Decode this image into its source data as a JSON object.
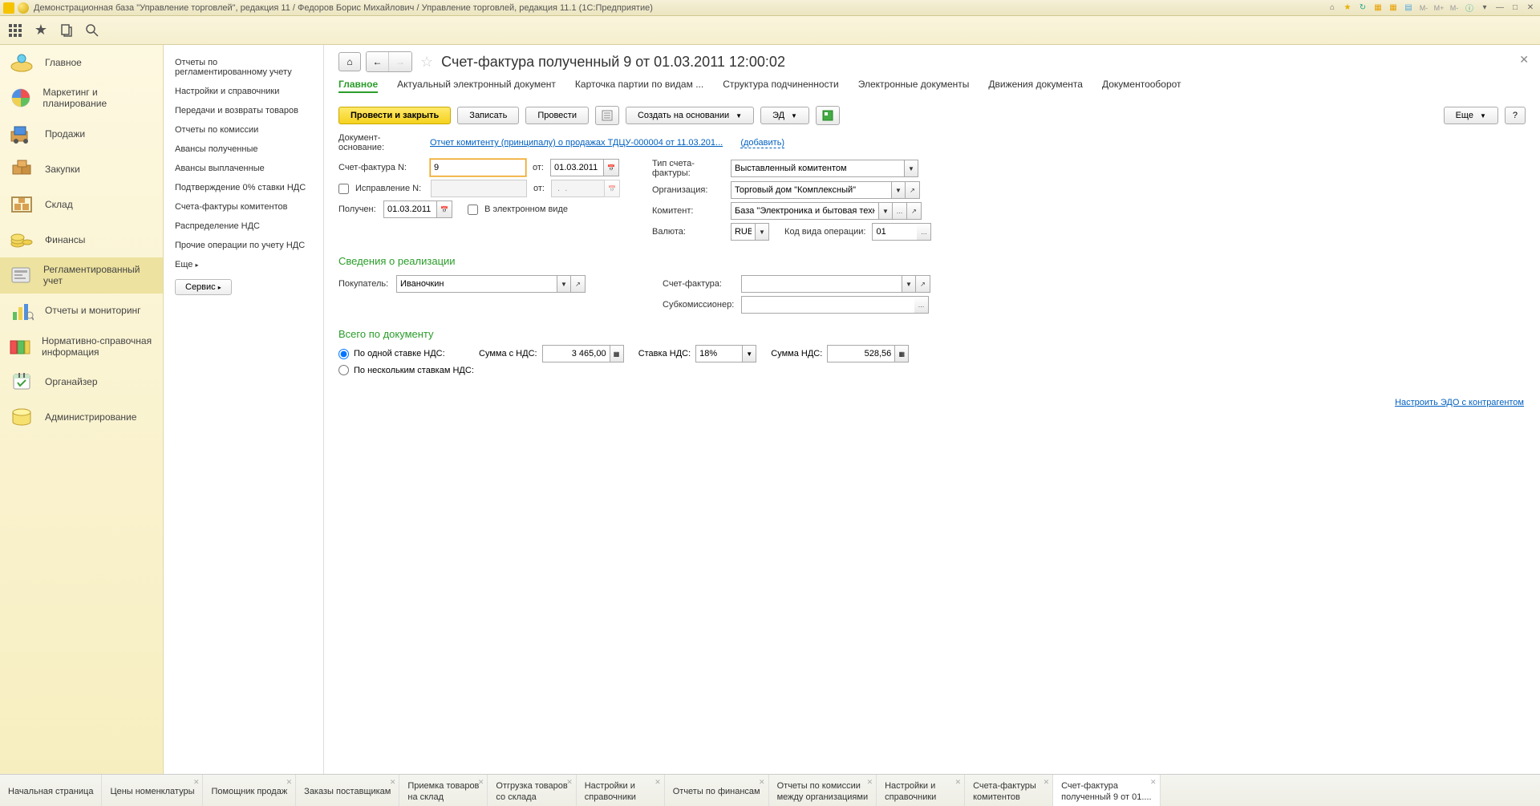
{
  "titlebar": {
    "text": "Демонстрационная база \"Управление торговлей\", редакция 11 / Федоров Борис Михайлович / Управление торговлей, редакция 11.1  (1С:Предприятие)"
  },
  "sidebar": {
    "items": [
      {
        "label": "Главное"
      },
      {
        "label": "Маркетинг и планирование"
      },
      {
        "label": "Продажи"
      },
      {
        "label": "Закупки"
      },
      {
        "label": "Склад"
      },
      {
        "label": "Финансы"
      },
      {
        "label": "Регламентированный учет"
      },
      {
        "label": "Отчеты и мониторинг"
      },
      {
        "label": "Нормативно-справочная информация"
      },
      {
        "label": "Органайзер"
      },
      {
        "label": "Администрирование"
      }
    ]
  },
  "submenu": {
    "items": [
      "Отчеты по регламентированному учету",
      "Настройки и справочники",
      "Передачи и возвраты товаров",
      "Отчеты по комиссии",
      "Авансы полученные",
      "Авансы выплаченные",
      "Подтверждение 0% ставки НДС",
      "Счета-фактуры комитентов",
      "Распределение НДС",
      "Прочие операции по учету НДС"
    ],
    "more": "Еще",
    "service": "Сервис"
  },
  "doc": {
    "title": "Счет-фактура полученный 9 от 01.03.2011 12:00:02",
    "tabs": [
      "Главное",
      "Актуальный электронный документ",
      "Карточка партии по видам ...",
      "Структура подчиненности",
      "Электронные документы",
      "Движения документа",
      "Документооборот"
    ],
    "buttons": {
      "post_close": "Провести и закрыть",
      "save": "Записать",
      "post": "Провести",
      "create_based": "Создать на основании",
      "ed": "ЭД",
      "more": "Еще",
      "q": "?"
    },
    "basis_label": "Документ-основание:",
    "basis_link": "Отчет комитенту (принципалу) о продажах ТДЦУ-000004 от 11.03.201...",
    "add_link": "(добавить)",
    "fields": {
      "sf_num_label": "Счет-фактура N:",
      "sf_num": "9",
      "ot": "от:",
      "sf_date": "01.03.2011",
      "type_label": "Тип счета-фактуры:",
      "type_value": "Выставленный комитентом",
      "ispr_label": "Исправление N:",
      "ispr_date": " .  .    ",
      "org_label": "Организация:",
      "org_value": "Торговый дом \"Комплексный\"",
      "received_label": "Получен:",
      "received_date": "01.03.2011",
      "electronic_label": "В электронном виде",
      "komitent_label": "Комитент:",
      "komitent_value": "База \"Электроника и бытовая техника\"",
      "currency_label": "Валюта:",
      "currency_value": "RUB",
      "op_code_label": "Код вида операции:",
      "op_code_value": "01"
    },
    "section_realization": "Сведения о реализации",
    "realization": {
      "buyer_label": "Покупатель:",
      "buyer_value": "Иваночкин",
      "sf_label": "Счет-фактура:",
      "sf_value": "",
      "sub_label": "Субкомиссионер:",
      "sub_value": ""
    },
    "section_total": "Всего по документу",
    "total": {
      "single_rate": "По одной ставке НДС:",
      "multi_rate": "По нескольким ставкам НДС:",
      "sum_with_vat_label": "Сумма с НДС:",
      "sum_with_vat": "3 465,00",
      "vat_rate_label": "Ставка НДС:",
      "vat_rate": "18%",
      "vat_sum_label": "Сумма НДС:",
      "vat_sum": "528,56"
    },
    "edo_link": "Настроить ЭДО с контрагентом"
  },
  "bottom_tabs": [
    {
      "l1": "Начальная страница",
      "closable": false
    },
    {
      "l1": "Цены номенклатуры",
      "closable": true
    },
    {
      "l1": "Помощник продаж",
      "closable": true
    },
    {
      "l1": "Заказы поставщикам",
      "closable": true
    },
    {
      "l1": "Приемка товаров",
      "l2": "на склад",
      "closable": true
    },
    {
      "l1": "Отгрузка товаров",
      "l2": "со склада",
      "closable": true
    },
    {
      "l1": "Настройки и",
      "l2": "справочники",
      "closable": true
    },
    {
      "l1": "Отчеты по финансам",
      "closable": true
    },
    {
      "l1": "Отчеты по комиссии",
      "l2": "между организациями",
      "closable": true
    },
    {
      "l1": "Настройки и",
      "l2": "справочники",
      "closable": true
    },
    {
      "l1": "Счета-фактуры",
      "l2": "комитентов",
      "closable": true
    },
    {
      "l1": "Счет-фактура",
      "l2": "полученный 9 от 01....",
      "closable": true,
      "active": true
    }
  ]
}
